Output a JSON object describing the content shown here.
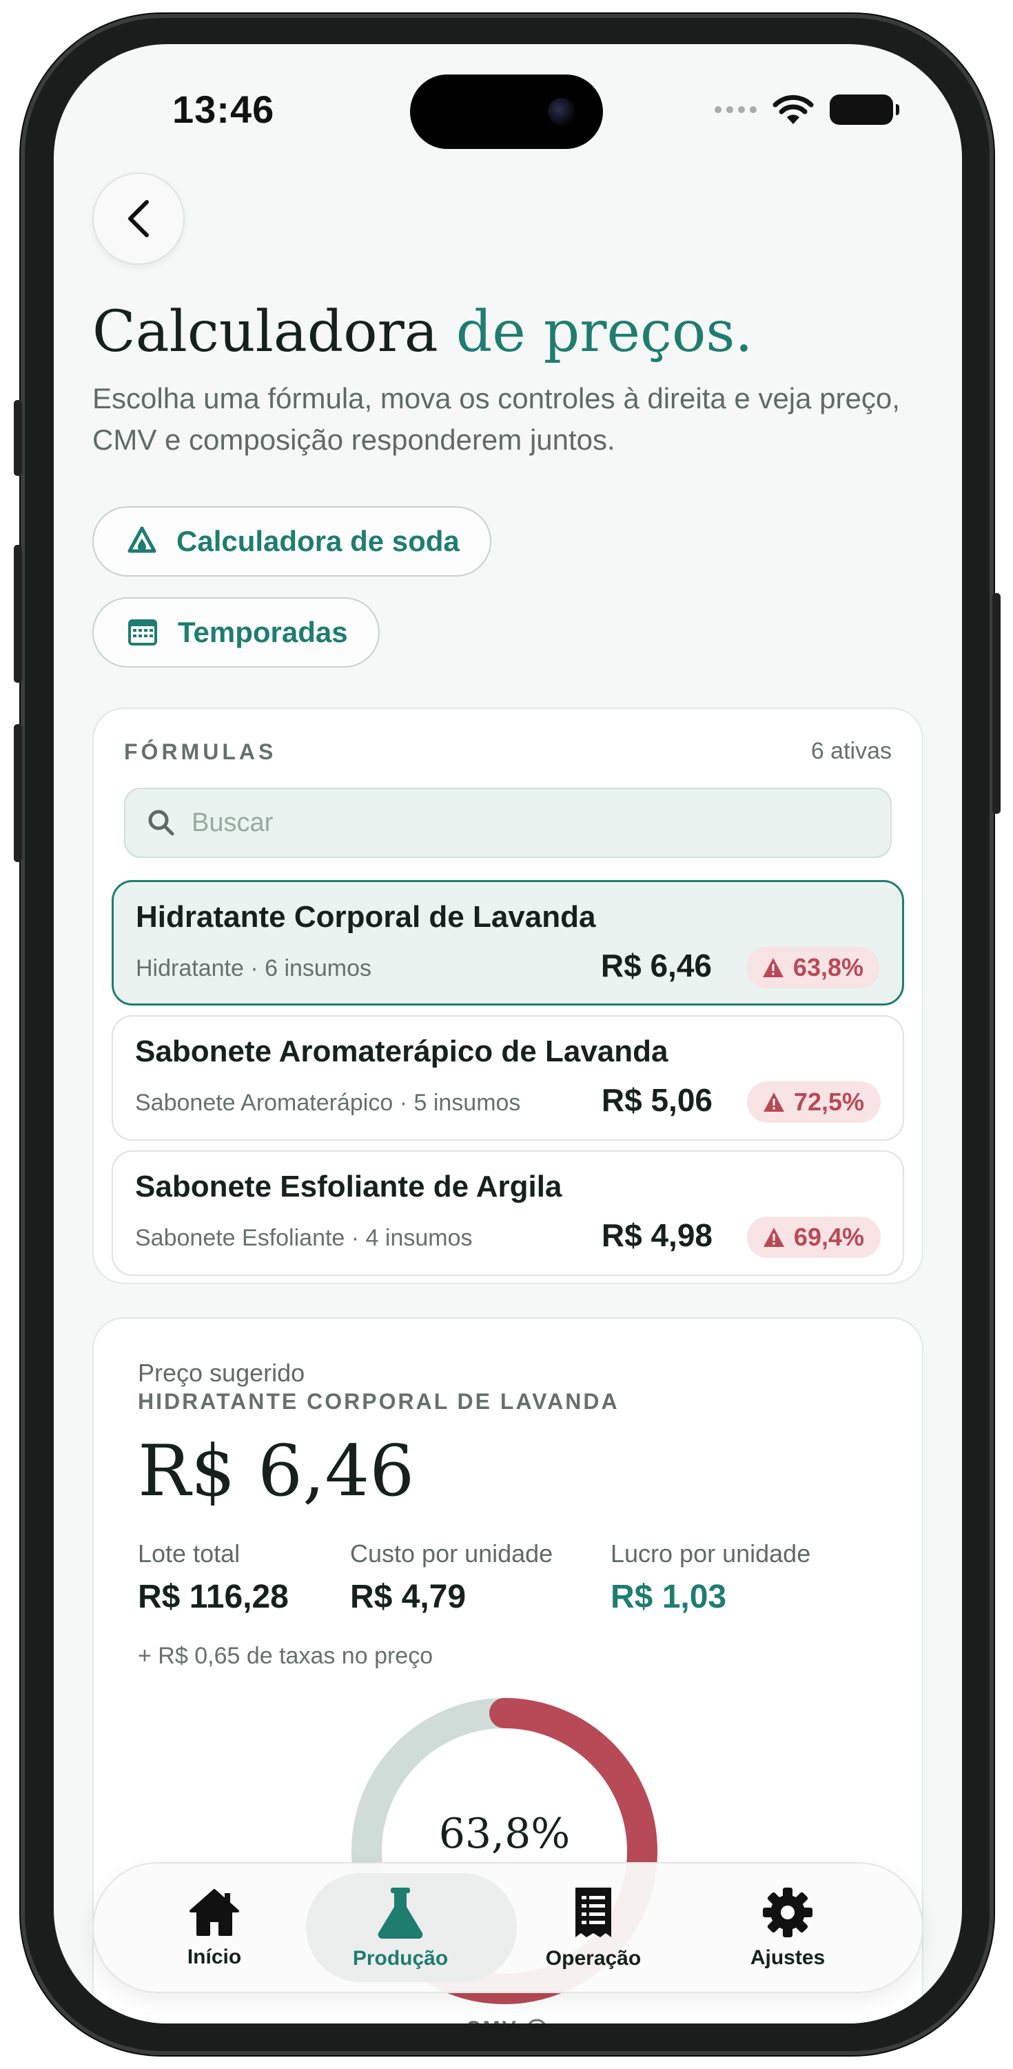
{
  "status_bar": {
    "time": "13:46"
  },
  "header": {
    "title_main": "Calculadora ",
    "title_accent": "de preços.",
    "subtitle": "Escolha uma fórmula, mova os controles à direita e veja preço, CMV e composição responderem juntos."
  },
  "actions": {
    "soda_calculator_label": "Calculadora de soda",
    "seasons_label": "Temporadas"
  },
  "formulas": {
    "heading": "FÓRMULAS",
    "count": "6 ativas",
    "search_placeholder": "Buscar",
    "items": [
      {
        "name": "Hidratante Corporal de Lavanda",
        "meta": "Hidratante · 6 insumos",
        "price": "R$ 6,46",
        "cmv": "63,8%",
        "selected": true
      },
      {
        "name": "Sabonete Aromaterápico de Lavanda",
        "meta": "Sabonete Aromaterápico · 5 insumos",
        "price": "R$ 5,06",
        "cmv": "72,5%",
        "selected": false
      },
      {
        "name": "Sabonete Esfoliante de Argila",
        "meta": "Sabonete Esfoliante · 4 insumos",
        "price": "R$ 4,98",
        "cmv": "69,4%",
        "selected": false
      }
    ]
  },
  "summary": {
    "label": "Preço sugerido",
    "formula_name": "HIDRATANTE CORPORAL DE LAVANDA",
    "price": "R$ 6,46",
    "batch_label": "Lote total",
    "batch_value": "R$ 116,28",
    "unit_cost_label": "Custo por unidade",
    "unit_cost_value": "R$ 4,79",
    "unit_profit_label": "Lucro por unidade",
    "unit_profit_value": "R$ 1,03",
    "fees_note": "+ R$ 0,65 de taxas no preço",
    "cmv_percent_label": "63,8%",
    "cmv_fraction": 0.638,
    "cmv_label": "CMV"
  },
  "tabbar": {
    "home": "Início",
    "production": "Produção",
    "operation": "Operação",
    "settings": "Ajustes"
  },
  "colors": {
    "accent": "#1f7d70",
    "danger": "#b84a57",
    "donut_track": "#cfdcd7",
    "donut_fill": "#b84a57"
  }
}
